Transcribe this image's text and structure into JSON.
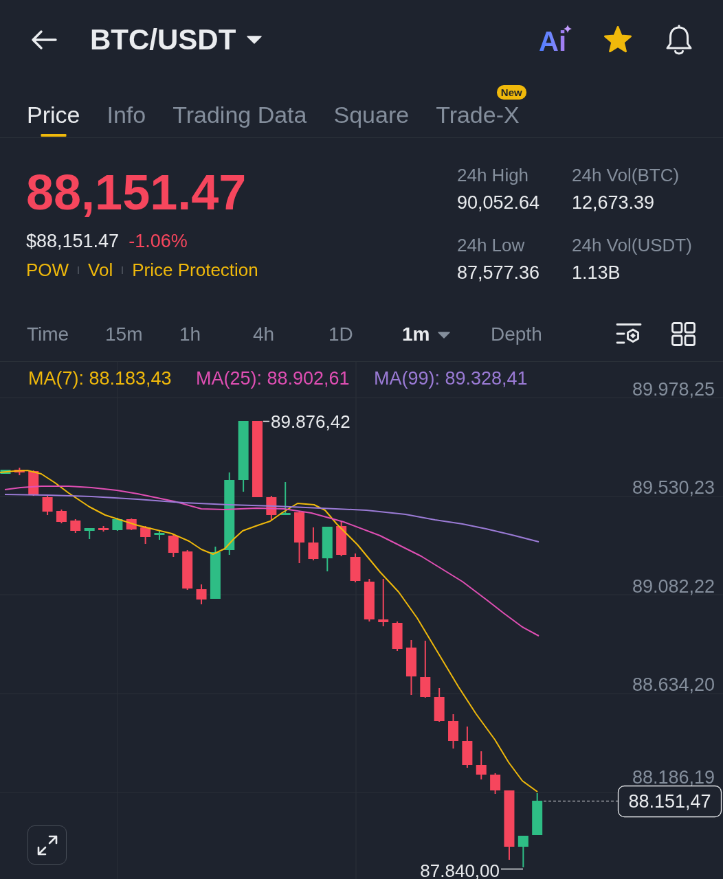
{
  "header": {
    "title": "BTC/USDT",
    "ai_label": "Ai",
    "favorite": true
  },
  "tabs": [
    {
      "label": "Price",
      "selected": true
    },
    {
      "label": "Info",
      "selected": false
    },
    {
      "label": "Trading Data",
      "selected": false
    },
    {
      "label": "Square",
      "selected": false
    },
    {
      "label": "Trade-X",
      "selected": false,
      "badge": "New"
    }
  ],
  "price": {
    "last": "88,151.47",
    "usd_value": "$88,151.47",
    "change": "-1.06%",
    "tags": [
      "POW",
      "Vol",
      "Price Protection"
    ]
  },
  "stats": [
    {
      "label": "24h High",
      "value": "90,052.64"
    },
    {
      "label": "24h Vol(BTC)",
      "value": "12,673.39"
    },
    {
      "label": "24h Low",
      "value": "87,577.36"
    },
    {
      "label": "24h Vol(USDT)",
      "value": "1.13B"
    }
  ],
  "intervals": [
    {
      "label": "Time",
      "selected": false,
      "dropdown": false
    },
    {
      "label": "15m",
      "selected": false,
      "dropdown": false
    },
    {
      "label": "1h",
      "selected": false,
      "dropdown": false
    },
    {
      "label": "4h",
      "selected": false,
      "dropdown": false
    },
    {
      "label": "1D",
      "selected": false,
      "dropdown": false
    },
    {
      "label": "1m",
      "selected": true,
      "dropdown": true
    },
    {
      "label": "Depth",
      "selected": false,
      "dropdown": false
    }
  ],
  "chart": {
    "indicators": [
      {
        "label": "MA(7): 88.183,43",
        "color": "#f0b90b"
      },
      {
        "label": "MA(25): 88.902,61",
        "color": "#e04fb4"
      },
      {
        "label": "MA(99): 89.328,41",
        "color": "#9b7bd6"
      }
    ],
    "y_axis_labels": [
      "89.978,25",
      "89.530,23",
      "89.082,22",
      "88.634,20",
      "88.186,19"
    ],
    "high_label": "89.876,42",
    "low_label": "87.840,00",
    "last_price_label": "88.151,47"
  }
}
